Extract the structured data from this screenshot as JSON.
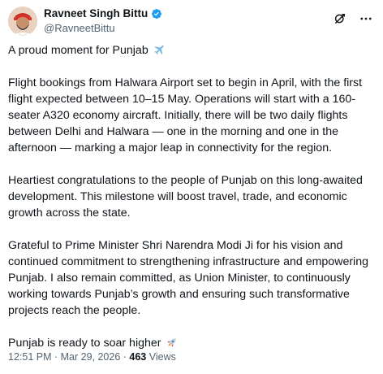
{
  "author": {
    "display_name": "Ravneet Singh Bittu",
    "handle": "@RavneetBittu",
    "verified": true
  },
  "colors": {
    "text": "#0f1419",
    "secondary": "#536471",
    "verified": "#1d9bf0"
  },
  "post": {
    "line1": "A proud moment for Punjab",
    "line1_emoji": "airplane",
    "para1": "Flight bookings from Halwara Airport set to begin in April, with the first flight expected between 10–15 May. Operations will start with a 160-seater A320 economy aircraft. Initially, there will be two daily flights between Delhi and Halwara — one in the morning and one in the afternoon — marking a major leap in connectivity for the region.",
    "para2": "Heartiest congratulations to the people of Punjab on this long-awaited development. This milestone will boost travel, trade, and economic growth across the state.",
    "para3": "Grateful to Prime Minister Shri Narendra Modi Ji for his vision and continued commitment to strengthening infrastructure and empowering Punjab. I also remain committed, as Union Minister, to continuously working towards Punjab’s growth and ensuring such transformative projects reach the people.",
    "closing": "Punjab is ready to soar higher",
    "closing_emoji": "rocket"
  },
  "meta": {
    "time": "12:51 PM",
    "separator": " · ",
    "date": "Mar 29, 2026",
    "views_count": "463",
    "views_label": " Views"
  },
  "icons": {
    "grok": "grok-icon",
    "more": "more-icon"
  }
}
